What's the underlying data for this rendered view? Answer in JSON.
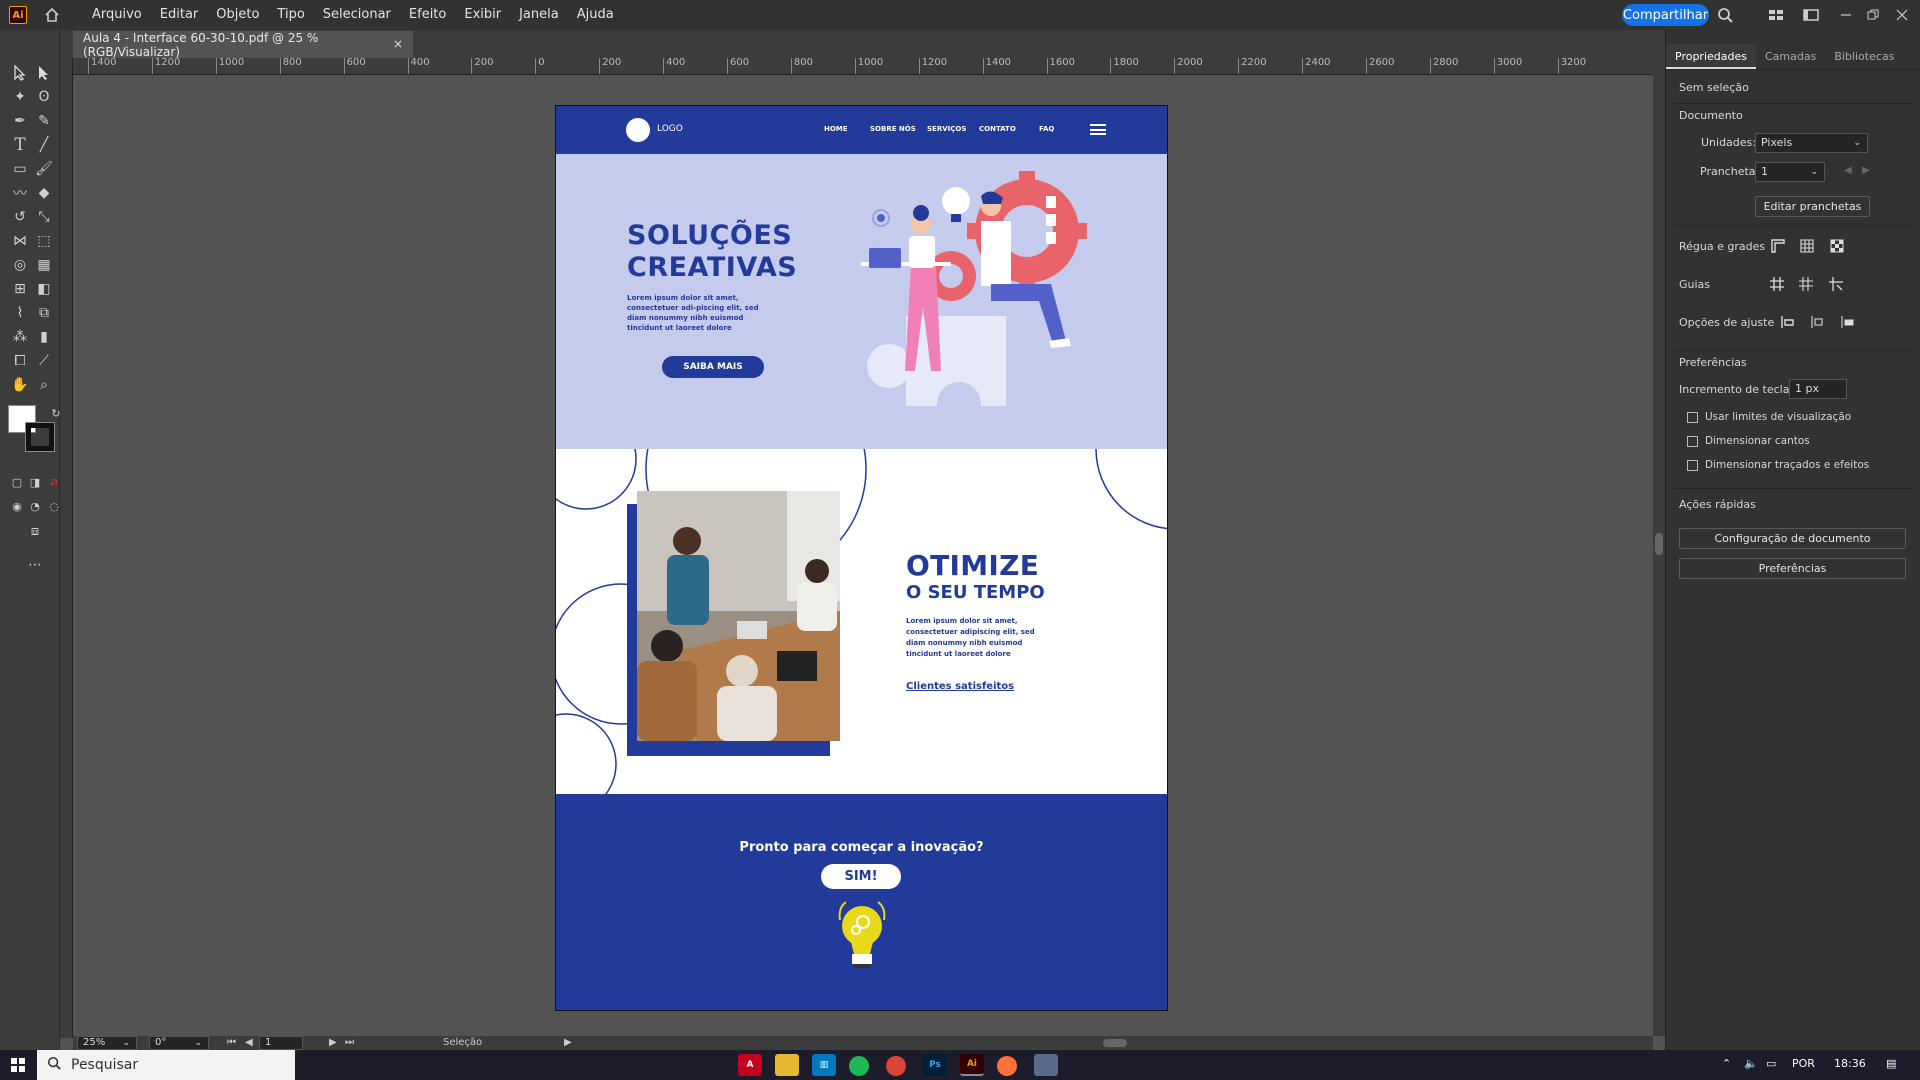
{
  "app": {
    "menu": [
      "Arquivo",
      "Editar",
      "Objeto",
      "Tipo",
      "Selecionar",
      "Efeito",
      "Exibir",
      "Janela",
      "Ajuda"
    ],
    "share_label": "Compartilhar",
    "logo_label": "Ai"
  },
  "document": {
    "tab_title": "Aula 4 - Interface 60-30-10.pdf @ 25 % (RGB/Visualizar)",
    "close_glyph": "×"
  },
  "ruler": {
    "h_labels": [
      "1400",
      "1200",
      "1000",
      "800",
      "600",
      "400",
      "200",
      "0",
      "200",
      "400",
      "600",
      "800",
      "1000",
      "1200",
      "1400",
      "1600",
      "1800",
      "2000",
      "2200",
      "2400",
      "2600",
      "2800",
      "3000",
      "3200"
    ]
  },
  "artboard": {
    "nav": {
      "logo": "LOGO",
      "links": [
        "HOME",
        "SOBRE NÓS",
        "SERVIÇOS",
        "CONTATO",
        "FAQ"
      ]
    },
    "hero": {
      "title_line1": "SOLUÇÕES",
      "title_line2": "CREATIVAS",
      "text": "Lorem ipsum dolor sit amet, consectetuer adi-piscing elit, sed diam nonummy nibh euismod tincidunt ut laoreet dolore",
      "cta": "SAIBA MAIS"
    },
    "section2": {
      "title": "OTIMIZE",
      "subtitle": "O SEU TEMPO",
      "text": "Lorem ipsum dolor sit amet, consectetuer adipiscing elit, sed diam nonummy nibh euismod tincidunt ut laoreet dolore",
      "link": "Clientes satisfeitos"
    },
    "section3": {
      "question": "Pronto para começar a inovação?",
      "button": "SIM!"
    },
    "colors": {
      "primary": "#223a9a",
      "light": "#c5cbed",
      "accent_pink": "#f17fb8",
      "accent_coral": "#e8646a",
      "bulb_yellow": "#e8d91b"
    }
  },
  "statusbar": {
    "zoom": "25%",
    "rotation": "0°",
    "artboard_num": "1",
    "tool": "Seleção"
  },
  "panel": {
    "tabs": [
      "Propriedades",
      "Camadas",
      "Bibliotecas"
    ],
    "no_selection": "Sem seleção",
    "document_label": "Documento",
    "units_label": "Unidades:",
    "units_value": "Pixels",
    "artboards_label": "Pranchetas:",
    "artboards_value": "1",
    "edit_artboards": "Editar pranchetas",
    "rulers_grids": "Régua e grades",
    "guides": "Guias",
    "snap_options": "Opções de ajuste",
    "preferences": "Preferências",
    "keyboard_increment_label": "Incremento de teclado:",
    "keyboard_increment_value": "1 px",
    "checkboxes": [
      "Usar limites de visualização",
      "Dimensionar cantos",
      "Dimensionar traçados e efeitos"
    ],
    "quick_actions": "Ações rápidas",
    "doc_setup": "Configuração de documento",
    "prefs_button": "Preferências"
  },
  "taskbar": {
    "search_placeholder": "Pesquisar",
    "lang": "POR",
    "time": "18:36"
  }
}
